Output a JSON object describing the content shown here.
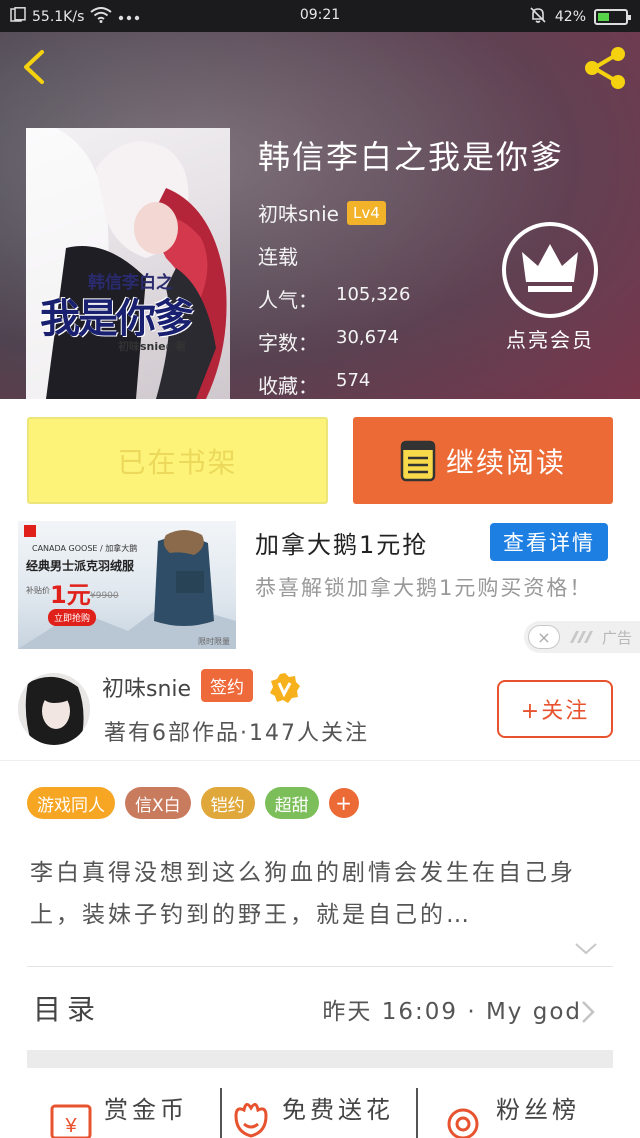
{
  "status_bar": {
    "net_speed": "55.1K/s",
    "time": "09:21",
    "battery": "42%",
    "battery_level": 0.42
  },
  "header": {
    "back_icon": "chevron-left-icon",
    "share_icon": "share-icon",
    "cover": {
      "subtitle": "韩信李白之",
      "title": "我是你爹",
      "author": "初味snie◎著"
    },
    "book_title": "韩信李白之我是你爹",
    "author": "初味snie",
    "level": "Lv4",
    "status": "连载",
    "popularity_label": "人气：",
    "popularity": "105,326",
    "words_label": "字数：",
    "words": "30,674",
    "favorites_label": "收藏：",
    "favorites": "574",
    "vip_label": "点亮会员",
    "vip_icon": "crown-icon"
  },
  "actions": {
    "on_shelf": "已在书架",
    "continue_read": "继续阅读",
    "book_icon": "book-icon"
  },
  "ad": {
    "image": {
      "brand": "CANADA GOOSE / 加拿大鹅",
      "headline": "经典男士派克羽绒服",
      "price": "1元",
      "price_prefix": "补贴价",
      "old_price": "¥9900",
      "buy_btn": "立即抢购",
      "limit": "限时限量"
    },
    "title": "加拿大鹅1元抢",
    "cta": "查看详情",
    "desc": "恭喜解锁加拿大鹅1元购买资格！",
    "close": "×",
    "tag": "广告"
  },
  "author_sec": {
    "name": "初味snie",
    "sign_badge": "签约",
    "verified_icon": "v-badge-icon",
    "meta": "著有6部作品·147人关注",
    "follow": "+关注"
  },
  "tags": [
    {
      "label": "游戏同人",
      "color": "#f6a623"
    },
    {
      "label": "信X白",
      "color": "#c97b5e"
    },
    {
      "label": "铠约",
      "color": "#e0a83a"
    },
    {
      "label": "超甜",
      "color": "#7cbf5a"
    }
  ],
  "tag_plus": "+",
  "description": "李白真得没想到这么狗血的剧情会发生在自己身上，装妹子钓到的野王，就是自己的…",
  "toc": {
    "label": "目录",
    "latest": "昨天 16:09 · My god"
  },
  "bottom_bar": {
    "reward": "赏金币",
    "flower": "免费送花",
    "fans": "粉丝榜"
  },
  "colors": {
    "accent": "#ec6a35",
    "shelf_yellow": "#fcf378",
    "ad_blue": "#1e7fe3"
  }
}
